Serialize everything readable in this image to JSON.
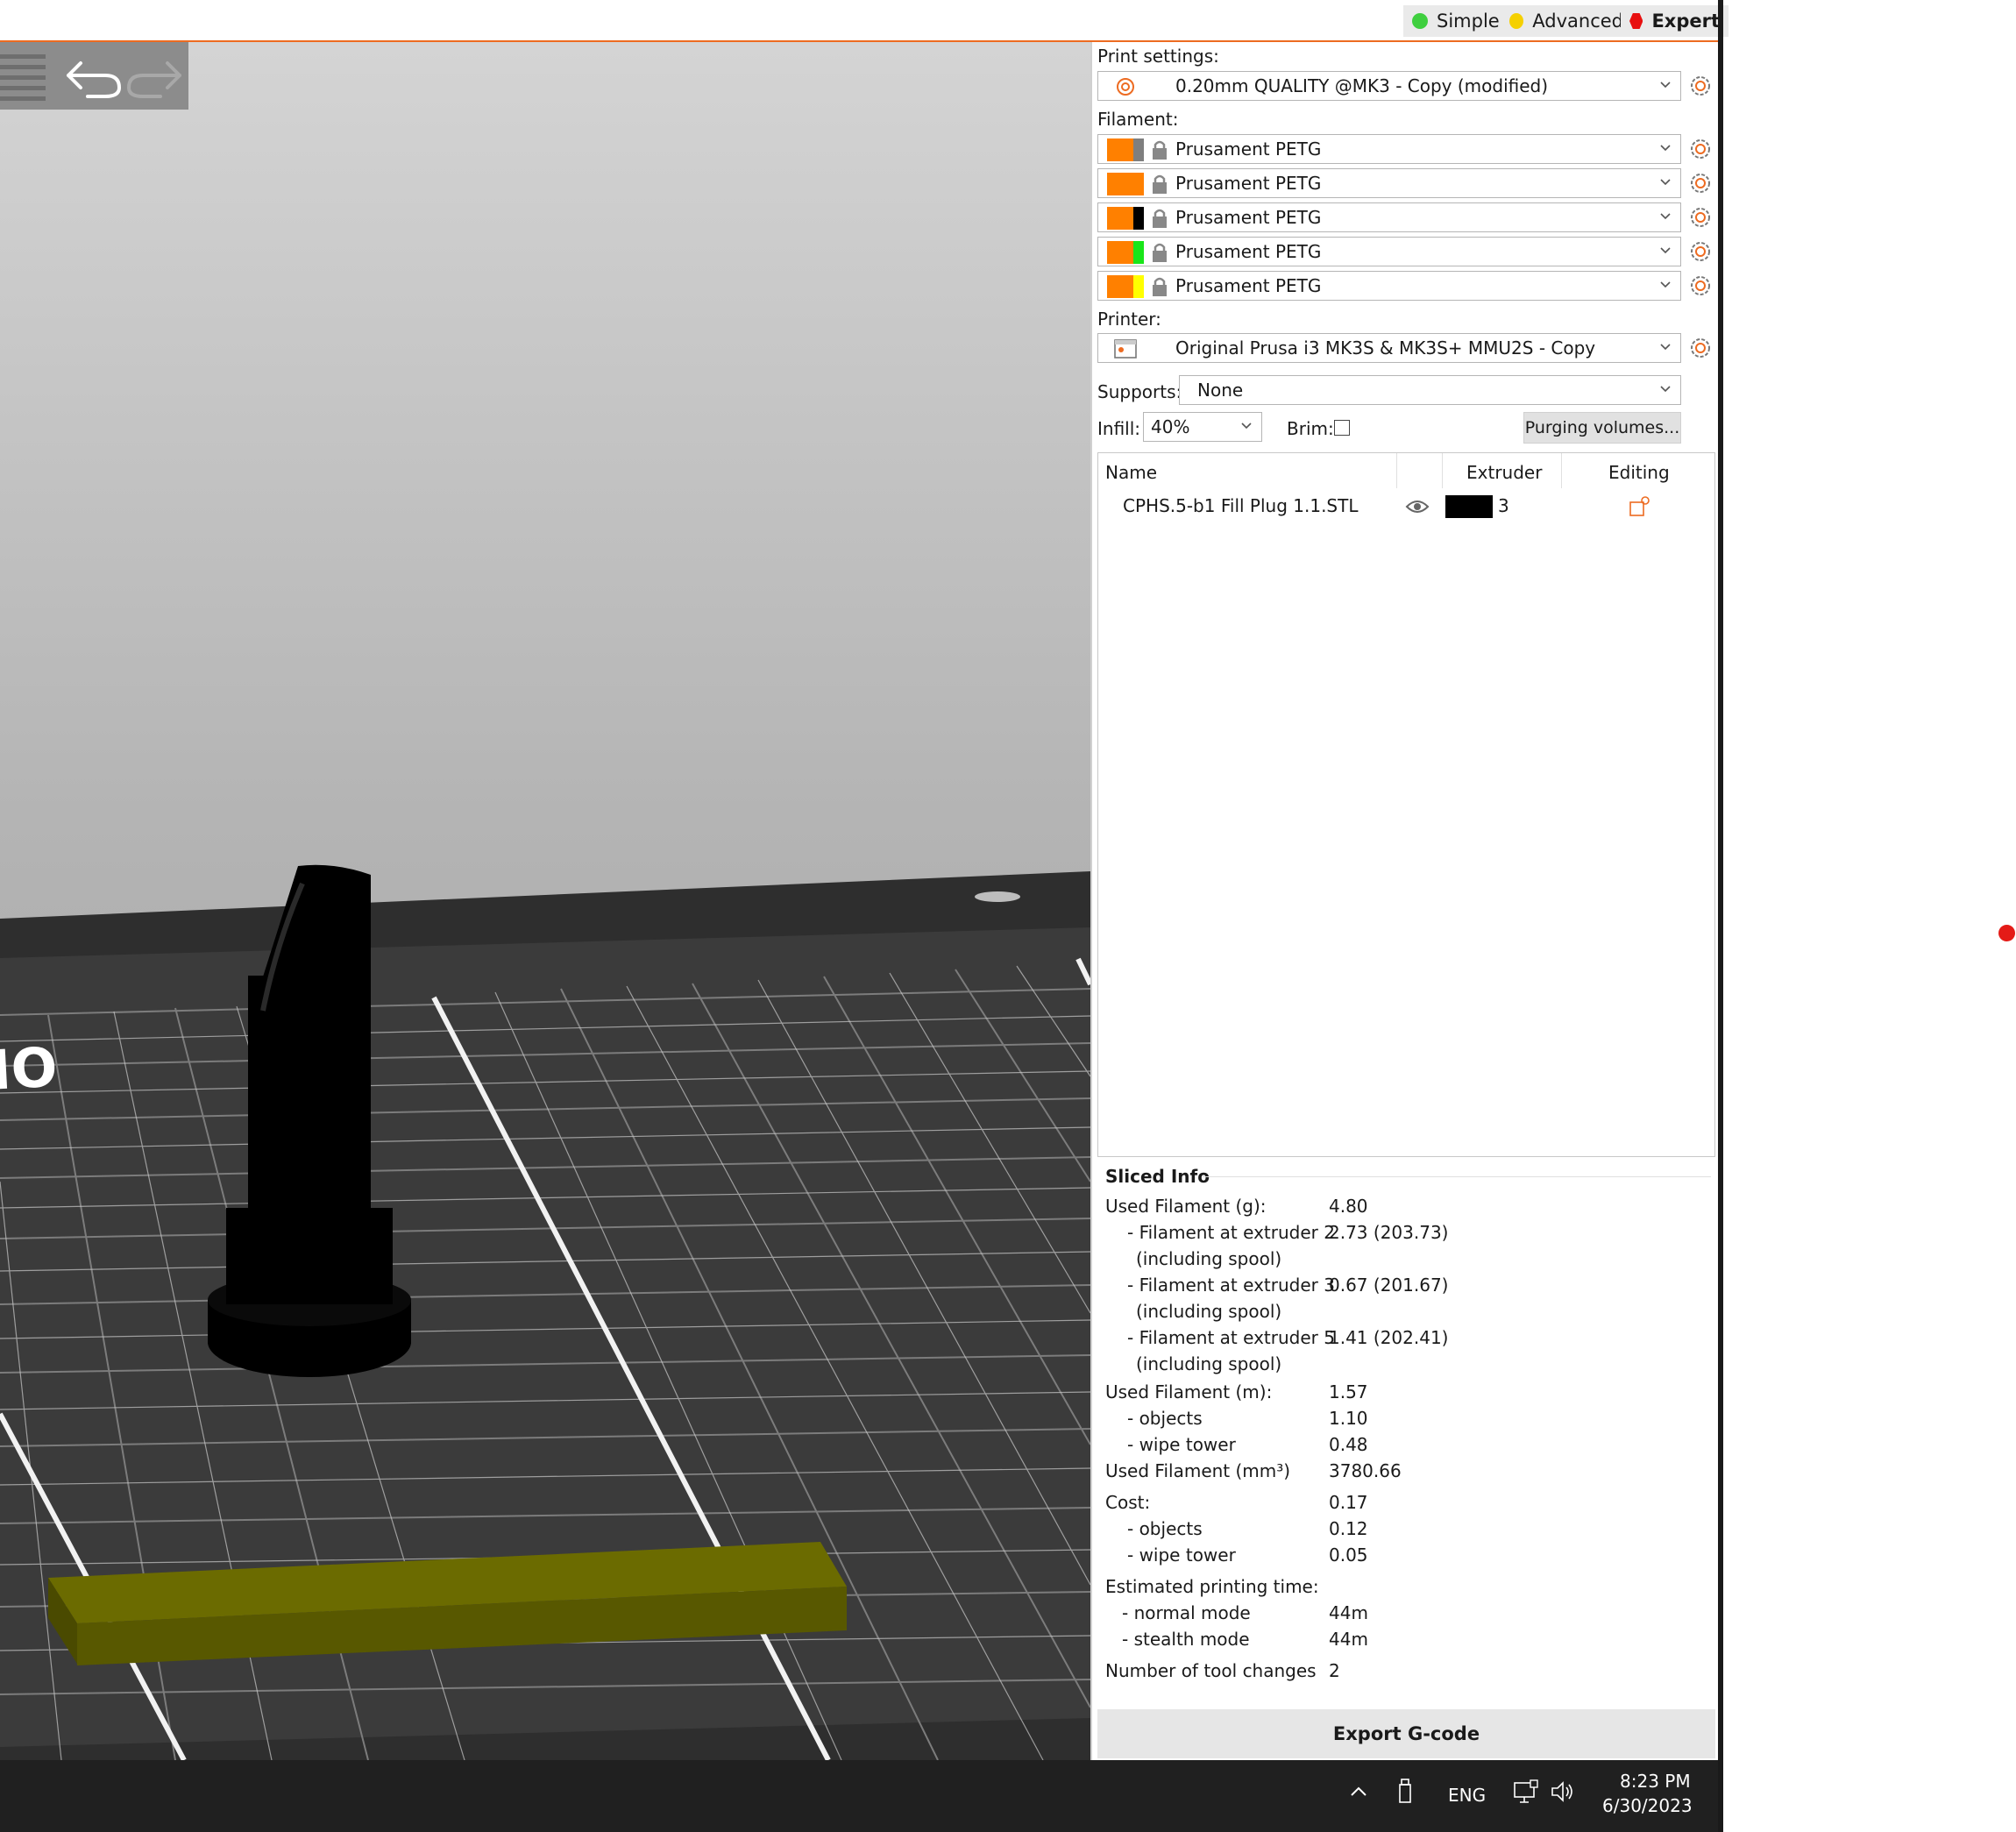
{
  "modes": {
    "simple": "Simple",
    "advanced": "Advanced",
    "expert": "Expert",
    "colors": {
      "simple": "#3fcf3f",
      "advanced": "#f5d000",
      "expert": "#e81010"
    }
  },
  "accent_color": "#ed6b21",
  "print_settings": {
    "label": "Print settings:",
    "value": "0.20mm QUALITY @MK3 - Copy (modified)"
  },
  "filament": {
    "label": "Filament:",
    "items": [
      {
        "name": "Prusament PETG",
        "colors": [
          "#ff8000",
          "#7f7f7f"
        ]
      },
      {
        "name": "Prusament PETG",
        "colors": [
          "#ff8000",
          "#ff8000"
        ]
      },
      {
        "name": "Prusament PETG",
        "colors": [
          "#ff8000",
          "#000000"
        ]
      },
      {
        "name": "Prusament PETG",
        "colors": [
          "#ff8000",
          "#19e619"
        ]
      },
      {
        "name": "Prusament PETG",
        "colors": [
          "#ff8000",
          "#ffff00"
        ]
      }
    ]
  },
  "printer": {
    "label": "Printer:",
    "value": "Original Prusa i3 MK3S & MK3S+ MMU2S - Copy"
  },
  "supports": {
    "label": "Supports:",
    "value": "None"
  },
  "infill": {
    "label": "Infill:",
    "value": "40%"
  },
  "brim": {
    "label": "Brim:",
    "checked": false
  },
  "purging_button": "Purging volumes...",
  "object_list": {
    "columns": {
      "name": "Name",
      "extruder": "Extruder",
      "editing": "Editing"
    },
    "objects": [
      {
        "name": "CPHS.5-b1 Fill Plug 1.1.STL",
        "extruder": "3",
        "extruder_color": "#000000"
      }
    ]
  },
  "sliced_info": {
    "title": "Sliced Info",
    "rows": [
      {
        "label": "Used Filament (g):",
        "value": "4.80",
        "indent": 0
      },
      {
        "label": "- Filament at extruder 2",
        "value": "2.73 (203.73)",
        "indent": 1
      },
      {
        "label": "(including spool)",
        "value": "",
        "indent": 2
      },
      {
        "label": "- Filament at extruder 3",
        "value": "0.67 (201.67)",
        "indent": 1
      },
      {
        "label": "(including spool)",
        "value": "",
        "indent": 2
      },
      {
        "label": "- Filament at extruder 5",
        "value": "1.41 (202.41)",
        "indent": 1
      },
      {
        "label": "(including spool)",
        "value": "",
        "indent": 2
      },
      {
        "label": "Used Filament (m):",
        "value": "1.57",
        "indent": 0
      },
      {
        "label": "- objects",
        "value": "1.10",
        "indent": 1
      },
      {
        "label": "- wipe tower",
        "value": "0.48",
        "indent": 1
      },
      {
        "label": "Used Filament (mm³)",
        "value": "3780.66",
        "indent": 0
      },
      {
        "label": "Cost:",
        "value": "0.17",
        "indent": 0
      },
      {
        "label": "- objects",
        "value": "0.12",
        "indent": 1
      },
      {
        "label": "- wipe tower",
        "value": "0.05",
        "indent": 1
      },
      {
        "label": "Estimated printing time:",
        "value": "",
        "indent": 0
      },
      {
        "label": "- normal mode",
        "value": "44m",
        "indent": 1
      },
      {
        "label": "- stealth mode",
        "value": "44m",
        "indent": 1
      },
      {
        "label": "Number of tool changes",
        "value": "2",
        "indent": 0
      }
    ]
  },
  "export_button": "Export G-code",
  "taskbar": {
    "language": "ENG",
    "time": "8:23 PM",
    "date": "6/30/2023"
  },
  "icons": {
    "undo": "undo-icon",
    "redo": "redo-icon",
    "settings": "gear-icon",
    "lock": "lock-icon",
    "visibility": "eye-icon",
    "edit": "edit-settings-icon",
    "printer": "printer-icon"
  }
}
